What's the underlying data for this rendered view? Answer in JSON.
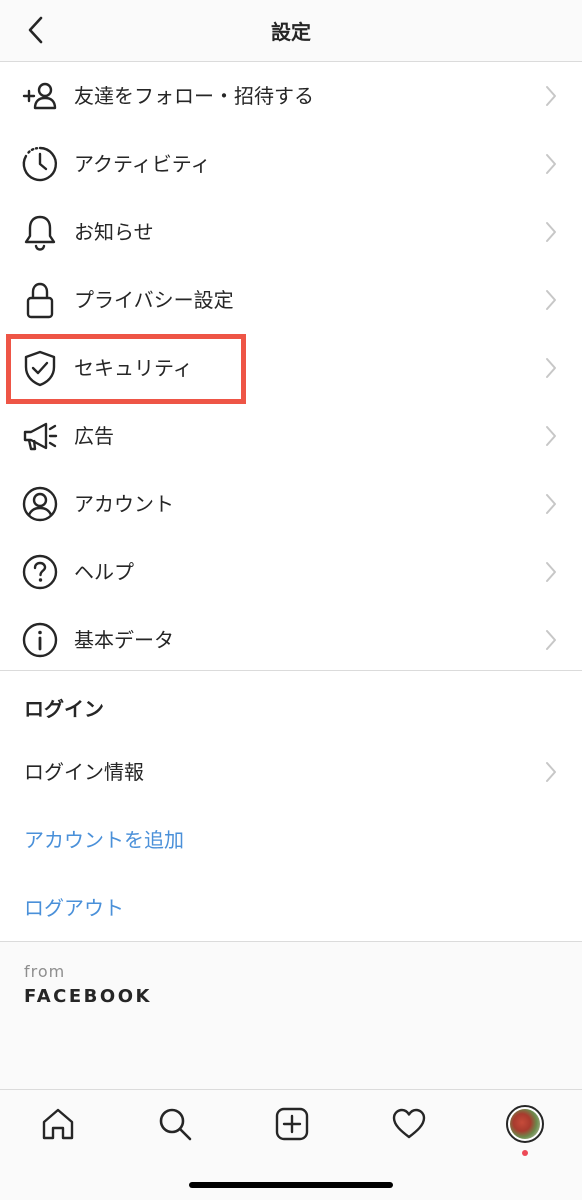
{
  "header": {
    "title": "設定",
    "back_icon": "chevron-left-icon"
  },
  "menu": {
    "items": [
      {
        "label": "友達をフォロー・招待する",
        "icon": "add-person-icon"
      },
      {
        "label": "アクティビティ",
        "icon": "activity-clock-icon"
      },
      {
        "label": "お知らせ",
        "icon": "bell-icon"
      },
      {
        "label": "プライバシー設定",
        "icon": "lock-icon"
      },
      {
        "label": "セキュリティ",
        "icon": "shield-check-icon",
        "highlighted": true
      },
      {
        "label": "広告",
        "icon": "megaphone-icon"
      },
      {
        "label": "アカウント",
        "icon": "account-circle-icon"
      },
      {
        "label": "ヘルプ",
        "icon": "help-circle-icon"
      },
      {
        "label": "基本データ",
        "icon": "info-circle-icon"
      }
    ]
  },
  "login": {
    "section_title": "ログイン",
    "login_info_label": "ログイン情報",
    "add_account_label": "アカウントを追加",
    "logout_label": "ログアウト"
  },
  "footer": {
    "from_label": "from",
    "brand_label": "FACEBOOK"
  },
  "tabbar": {
    "tabs": [
      "home-icon",
      "search-icon",
      "new-post-icon",
      "activity-heart-icon",
      "profile-avatar"
    ]
  },
  "colors": {
    "link": "#4a90d9",
    "highlight_border": "#ee5546",
    "text": "#262626",
    "notification_dot": "#ed4956"
  }
}
